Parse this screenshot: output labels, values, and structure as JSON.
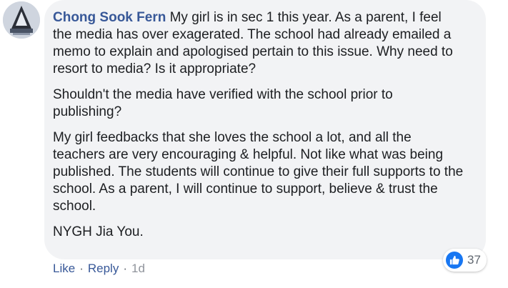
{
  "comment": {
    "author": "Chong Sook Fern",
    "paragraphs": [
      "My girl is in sec 1 this year. As a parent, I feel\nthe media has over exagerated. The school had already emailed a\nmemo to explain and apologised pertain to this issue. Why need to\nresort to media? Is it appropriate?",
      "Shouldn't the media have verified with the school prior to\npublishing?",
      "My girl feedbacks that she loves the school a lot, and all the\nteachers are very encouraging & helpful. Not like what was being\npublished. The students will continue to give their full supports to the\nschool. As a parent, I will continue to support, believe & trust the\nschool.",
      "NYGH Jia You."
    ],
    "reactions": {
      "icon": "like-icon",
      "count": "37"
    },
    "actions": {
      "like_label": "Like",
      "separator": "·",
      "reply_label": "Reply",
      "timestamp": "1d"
    }
  },
  "colors": {
    "author": "#385898",
    "bubble": "#f2f3f5",
    "like_badge": "#1877f2"
  }
}
